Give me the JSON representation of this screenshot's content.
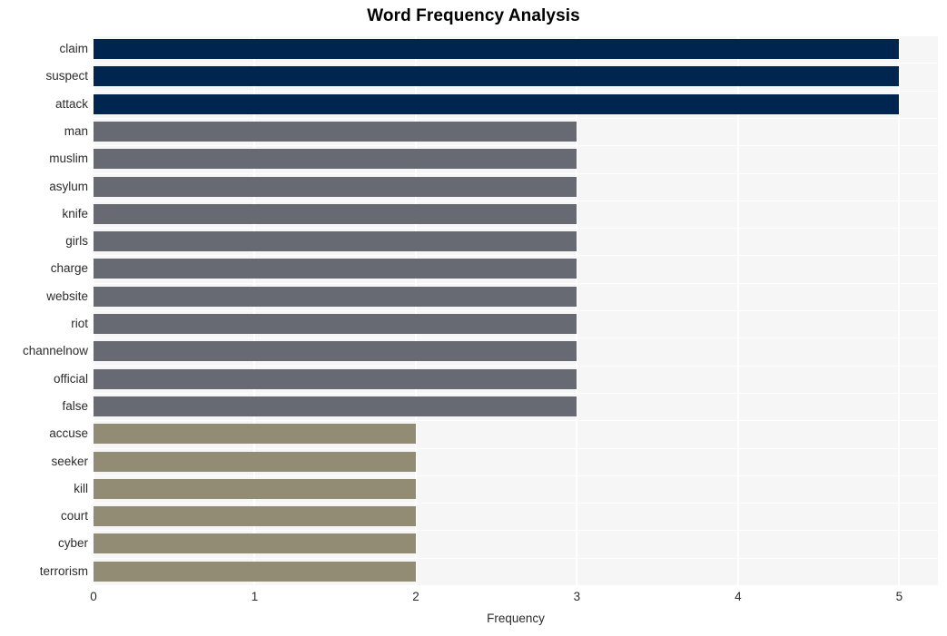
{
  "chart_data": {
    "type": "bar",
    "orientation": "horizontal",
    "title": "Word Frequency Analysis",
    "xlabel": "Frequency",
    "ylabel": "",
    "xlim": [
      0,
      5.24
    ],
    "xticks": [
      0,
      1,
      2,
      3,
      4,
      5
    ],
    "xtick_labels": [
      "0",
      "1",
      "2",
      "3",
      "4",
      "5"
    ],
    "grid": true,
    "grid_axis": "both",
    "legend": "none",
    "categories": [
      "claim",
      "suspect",
      "attack",
      "man",
      "muslim",
      "asylum",
      "knife",
      "girls",
      "charge",
      "website",
      "riot",
      "channelnow",
      "official",
      "false",
      "accuse",
      "seeker",
      "kill",
      "court",
      "cyber",
      "terrorism"
    ],
    "values": [
      5,
      5,
      5,
      3,
      3,
      3,
      3,
      3,
      3,
      3,
      3,
      3,
      3,
      3,
      2,
      2,
      2,
      2,
      2,
      2
    ],
    "bar_colors": [
      "#00264f",
      "#00264f",
      "#00264f",
      "#676a72",
      "#676a72",
      "#676a72",
      "#676a72",
      "#676a72",
      "#676a72",
      "#676a72",
      "#676a72",
      "#676a72",
      "#676a72",
      "#676a72",
      "#928c75",
      "#928c75",
      "#928c75",
      "#928c75",
      "#928c75",
      "#928c75"
    ],
    "palette": {
      "high": "#00264f",
      "mid": "#676a72",
      "low": "#928c75",
      "plot_background": "#f6f6f7",
      "figure_background": "#ffffff",
      "gridline": "#ffffff",
      "text": "#2b2b2b",
      "title_text": "#000000"
    }
  }
}
